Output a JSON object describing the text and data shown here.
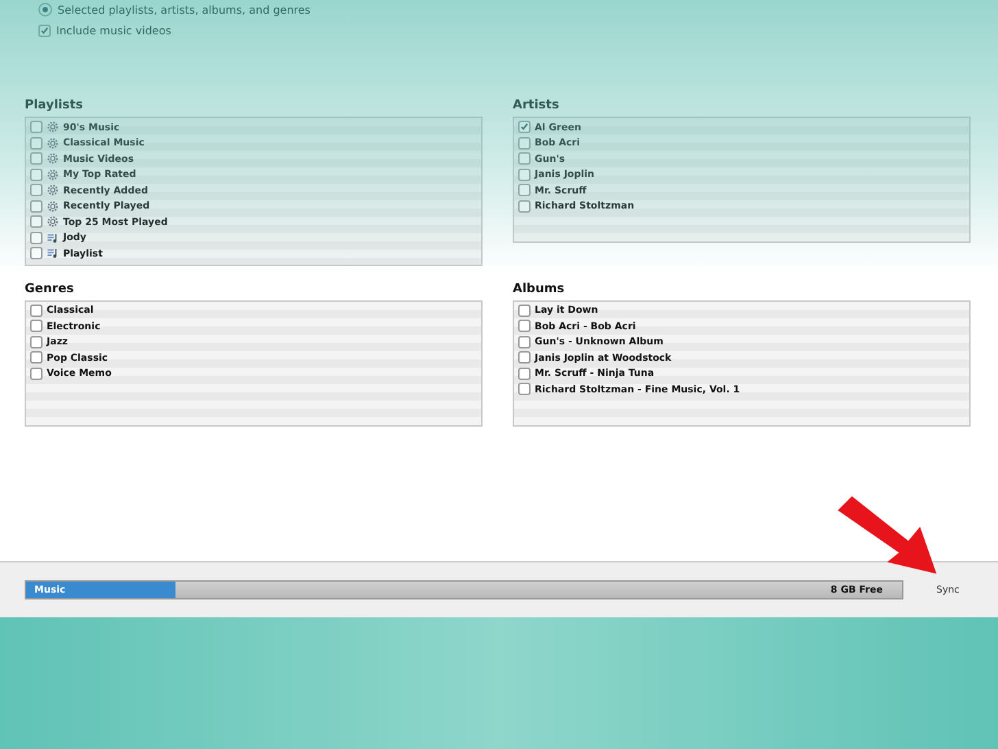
{
  "options": [
    {
      "kind": "radio",
      "label": "Selected playlists, artists, albums, and genres",
      "checked": true
    },
    {
      "kind": "checkbox",
      "label": "Include music videos",
      "checked": true
    }
  ],
  "sections": [
    {
      "title": "Playlists",
      "items": [
        {
          "kind": "smart",
          "label": "90's Music",
          "checked": false
        },
        {
          "kind": "smart",
          "label": "Classical Music",
          "checked": false
        },
        {
          "kind": "smart",
          "label": "Music Videos",
          "checked": false
        },
        {
          "kind": "smart",
          "label": "My Top Rated",
          "checked": false
        },
        {
          "kind": "smart",
          "label": "Recently Added",
          "checked": false
        },
        {
          "kind": "smart",
          "label": "Recently Played",
          "checked": false
        },
        {
          "kind": "smart",
          "label": "Top 25 Most Played",
          "checked": false
        },
        {
          "kind": "playlist",
          "label": "Jody",
          "checked": false
        },
        {
          "kind": "playlist",
          "label": "Playlist",
          "checked": false
        }
      ]
    },
    {
      "title": "Artists",
      "items": [
        {
          "kind": "plain",
          "label": "Al Green",
          "checked": true
        },
        {
          "kind": "plain",
          "label": "Bob Acri",
          "checked": false
        },
        {
          "kind": "plain",
          "label": "Gun's",
          "checked": false
        },
        {
          "kind": "plain",
          "label": "Janis Joplin",
          "checked": false
        },
        {
          "kind": "plain",
          "label": "Mr. Scruff",
          "checked": false
        },
        {
          "kind": "plain",
          "label": "Richard Stoltzman",
          "checked": false
        }
      ]
    },
    {
      "title": "Genres",
      "items": [
        {
          "kind": "plain",
          "label": "Classical",
          "checked": false
        },
        {
          "kind": "plain",
          "label": "Electronic",
          "checked": false
        },
        {
          "kind": "plain",
          "label": "Jazz",
          "checked": false
        },
        {
          "kind": "plain",
          "label": "Pop Classic",
          "checked": false
        },
        {
          "kind": "plain",
          "label": "Voice Memo",
          "checked": false
        }
      ]
    },
    {
      "title": "Albums",
      "items": [
        {
          "kind": "plain",
          "label": "Lay it Down",
          "checked": false
        },
        {
          "kind": "plain",
          "label": "Bob Acri - Bob Acri",
          "checked": false
        },
        {
          "kind": "plain",
          "label": "Gun's - Unknown Album",
          "checked": false
        },
        {
          "kind": "plain",
          "label": "Janis Joplin at Woodstock",
          "checked": false
        },
        {
          "kind": "plain",
          "label": "Mr. Scruff - Ninja Tuna",
          "checked": false
        },
        {
          "kind": "plain",
          "label": "Richard Stoltzman - Fine Music, Vol. 1",
          "checked": false
        }
      ]
    }
  ],
  "storage": {
    "segment": "Music",
    "level": 0.17,
    "free": "8 GB Free"
  },
  "sync_button": "Sync"
}
